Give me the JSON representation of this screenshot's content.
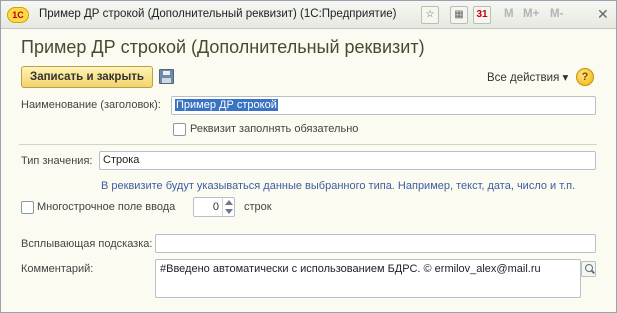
{
  "window": {
    "app_logo": "1С",
    "title": "Пример ДР строкой (Дополнительный реквизит)  (1С:Предприятие)",
    "toolbar_icons": [
      "favorite-icon",
      "calculator-icon",
      "calendar-icon"
    ],
    "calendar_label": "31",
    "memory_buttons": [
      "M",
      "M+",
      "M-"
    ],
    "close_label": "✕"
  },
  "form": {
    "title": "Пример ДР строкой (Дополнительный реквизит)",
    "save_close_label": "Записать и закрыть",
    "all_actions_label": "Все действия ▾",
    "help_label": "?"
  },
  "fields": {
    "name_label": "Наименование (заголовок):",
    "name_value": "Пример ДР строкой",
    "required_label": "Реквизит заполнять обязательно",
    "type_label": "Тип значения:",
    "type_value": "Строка",
    "type_hint": "В реквизите будут указываться данные выбранного типа. Например, текст, дата, число и т.п.",
    "multiline_label": "Многострочное поле ввода",
    "lines_value": "0",
    "lines_suffix": "строк",
    "tooltip_label": "Всплывающая подсказка:",
    "tooltip_value": "",
    "comment_label": "Комментарий:",
    "comment_value": "#Введено автоматически с использованием БДРС. © ermilov_alex@mail.ru"
  },
  "colors": {
    "background": "#fbfbf1",
    "accent_button": "#f3d46a",
    "hint_text": "#3c5ea0",
    "selection": "#3a72c4"
  }
}
